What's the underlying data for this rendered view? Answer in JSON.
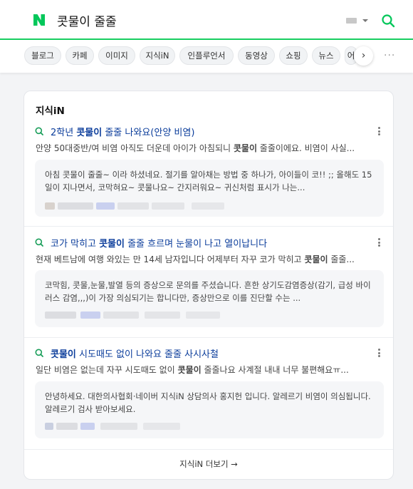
{
  "search": {
    "query": "콧물이 줄줄"
  },
  "colors": {
    "brand": "#03c75a",
    "title_link": "#0b3d9b"
  },
  "tabs": [
    "블로그",
    "카페",
    "이미지",
    "지식iN",
    "인플루언서",
    "동영상",
    "쇼핑",
    "뉴스",
    "어"
  ],
  "tabs_next_glyph": "›",
  "tabs_more_glyph": "···",
  "section": {
    "title": "지식iN",
    "items": [
      {
        "title_pre": "2학년 ",
        "title_bold": "콧물이",
        "title_post": " 줄줄 나와요(안양 비염)",
        "snippet_pre": "안양 50대중반/여 비염 아직도 더운데 아이가 아침되니 ",
        "snippet_bold": "콧물이",
        "snippet_post": " 줄줄이에요. 비염이 사실...",
        "answer": "아침 콧물이 줄줄~ 이라 하셨네요. 절기를 알아채는 방법 중 하나가, 아이들이 코!! ;; 올해도 15일이 지나면서, 코막혀요~ 콧물나요~ 간지러워요~ 귀신처럼 표시가 나는..."
      },
      {
        "title_pre": "코가 막히고 ",
        "title_bold": "콧물이",
        "title_post": " 줄줄 흐르며 눈물이 나고 열이납니다",
        "snippet_pre": "현재 베트남에 여행 와있는 만 14세 남자입니다 어제부터 자꾸 코가 막히고 ",
        "snippet_bold": "콧물이",
        "snippet_post": " 줄줄...",
        "answer": "코막힘, 콧물,눈물,발열 등의 증상으로 문의를 주셨습니다. 흔한 상기도감염증상(감기, 급성 바이러스 감염,,,)이 가장 의심되기는 합니다만, 증상만으로 이를 진단할 수는 ..."
      },
      {
        "title_pre": "",
        "title_bold": "콧물이",
        "title_post": " 시도때도 없이 나와요 줄줄 사시사철",
        "snippet_pre": "일단 비염은 없는데 자꾸 시도때도 없이 ",
        "snippet_bold": "콧물이",
        "snippet_post": " 줄줄나요 사계절 내내 너무 불편해요ㅠ...",
        "answer": "안녕하세요. 대한의사협회·네이버 지식iN 상담의사 홍지헌 입니다. 알레르기 비염이 의심됩니다. 알레르기 검사 받아보세요."
      }
    ],
    "more_label": "지식iN 더보기 →"
  }
}
